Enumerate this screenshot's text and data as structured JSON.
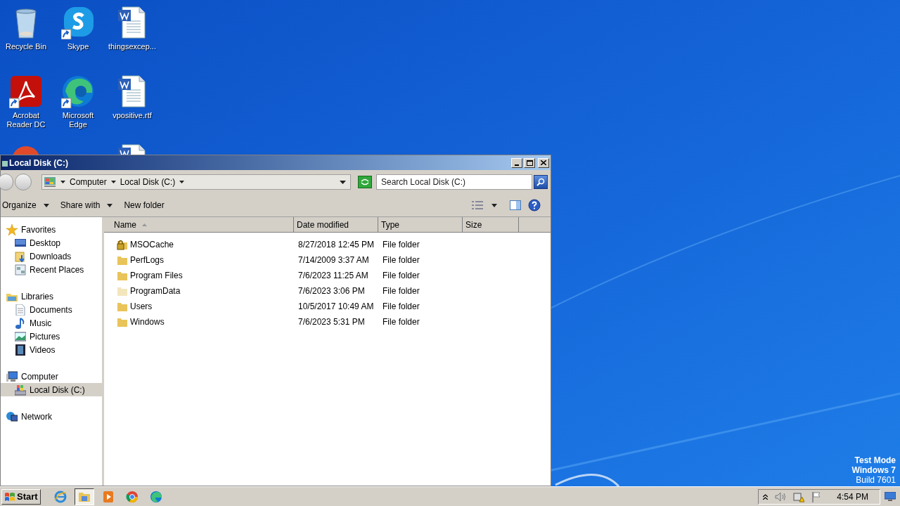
{
  "desktop_icons": [
    {
      "kind": "recycle",
      "label": "Recycle Bin"
    },
    {
      "kind": "skype",
      "label": "Skype"
    },
    {
      "kind": "word",
      "label": "thingsexcep..."
    },
    {
      "kind": "acrobat",
      "label": "Acrobat Reader DC"
    },
    {
      "kind": "edge",
      "label": "Microsoft Edge"
    },
    {
      "kind": "word",
      "label": "vpositive.rtf"
    },
    {
      "kind": "chrome-like"
    },
    {
      "kind": "blank"
    },
    {
      "kind": "word"
    }
  ],
  "window": {
    "title": "Local Disk (C:)",
    "breadcrumb": [
      "Computer",
      "Local Disk (C:)"
    ],
    "search": {
      "placeholder": "Search Local Disk (C:)"
    },
    "toolbar": [
      {
        "label": "Organize",
        "dropdown": true
      },
      {
        "label": "Share with",
        "dropdown": true
      },
      {
        "label": "New folder",
        "dropdown": false
      }
    ],
    "sidebar": [
      {
        "kind": "star",
        "label": "Favorites",
        "selected": false,
        "children": [
          {
            "kind": "desktop",
            "label": "Desktop",
            "selected": false
          },
          {
            "kind": "downloads",
            "label": "Downloads",
            "selected": false
          },
          {
            "kind": "recent",
            "label": "Recent Places",
            "selected": false
          }
        ]
      },
      {
        "kind": "libraries",
        "label": "Libraries",
        "selected": false,
        "children": [
          {
            "kind": "document",
            "label": "Documents",
            "selected": false
          },
          {
            "kind": "music",
            "label": "Music",
            "selected": false
          },
          {
            "kind": "pictures",
            "label": "Pictures",
            "selected": false
          },
          {
            "kind": "videos",
            "label": "Videos",
            "selected": false
          }
        ]
      },
      {
        "kind": "computer",
        "label": "Computer",
        "selected": false,
        "children": [
          {
            "kind": "disk",
            "label": "Local Disk (C:)",
            "selected": true
          }
        ]
      },
      {
        "kind": "network",
        "label": "Network",
        "selected": false
      }
    ],
    "table": {
      "columns": [
        "Name",
        "Date modified",
        "Type",
        "Size"
      ],
      "rows": [
        {
          "kind": "locked",
          "name": "MSOCache",
          "date": "8/27/2018 12:45 PM",
          "type": "File folder"
        },
        {
          "kind": "folder",
          "name": "PerfLogs",
          "date": "7/14/2009 3:37 AM",
          "type": "File folder"
        },
        {
          "kind": "folder",
          "name": "Program Files",
          "date": "7/6/2023 11:25 AM",
          "type": "File folder"
        },
        {
          "kind": "hidden",
          "name": "ProgramData",
          "date": "7/6/2023 3:06 PM",
          "type": "File folder"
        },
        {
          "kind": "folder",
          "name": "Users",
          "date": "10/5/2017 10:49 AM",
          "type": "File folder"
        },
        {
          "kind": "folder",
          "name": "Windows",
          "date": "7/6/2023 5:31 PM",
          "type": "File folder"
        }
      ]
    }
  },
  "watermark_text": [
    "Test Mode",
    "Windows 7",
    "Build 7601"
  ],
  "taskbar": {
    "start": "Start",
    "apps": [
      {
        "kind": "ie",
        "selected": false
      },
      {
        "kind": "explorer",
        "selected": true
      },
      {
        "kind": "media",
        "selected": false
      },
      {
        "kind": "chrome",
        "selected": false
      },
      {
        "kind": "edge",
        "selected": false
      }
    ],
    "clock": "4:54 PM"
  }
}
